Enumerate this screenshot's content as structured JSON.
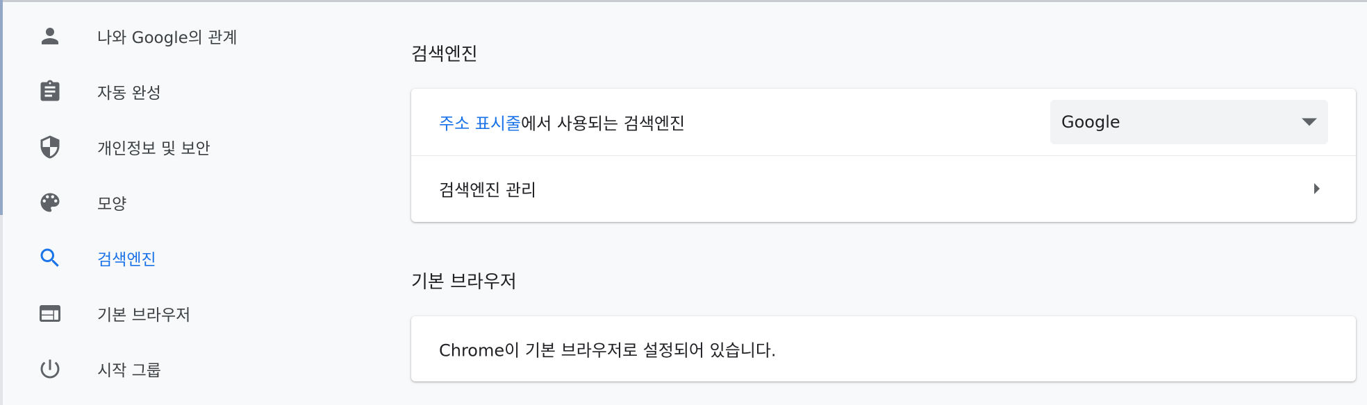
{
  "sidebar": {
    "items": [
      {
        "label": "나와 Google의 관계",
        "icon": "person-icon"
      },
      {
        "label": "자동 완성",
        "icon": "clipboard-icon"
      },
      {
        "label": "개인정보 및 보안",
        "icon": "shield-icon"
      },
      {
        "label": "모양",
        "icon": "palette-icon"
      },
      {
        "label": "검색엔진",
        "icon": "search-icon",
        "active": true
      },
      {
        "label": "기본 브라우저",
        "icon": "browser-icon"
      },
      {
        "label": "시작 그룹",
        "icon": "power-icon"
      }
    ]
  },
  "search_engine": {
    "title": "검색엔진",
    "address_bar_link": "주소 표시줄",
    "address_bar_rest": "에서 사용되는 검색엔진",
    "selected_engine": "Google",
    "manage_label": "검색엔진 관리"
  },
  "default_browser": {
    "title": "기본 브라우저",
    "status": "Chrome이 기본 브라우저로 설정되어 있습니다."
  },
  "colors": {
    "accent": "#1a73e8",
    "icon": "#5f6368",
    "background": "#f8f9fa"
  }
}
